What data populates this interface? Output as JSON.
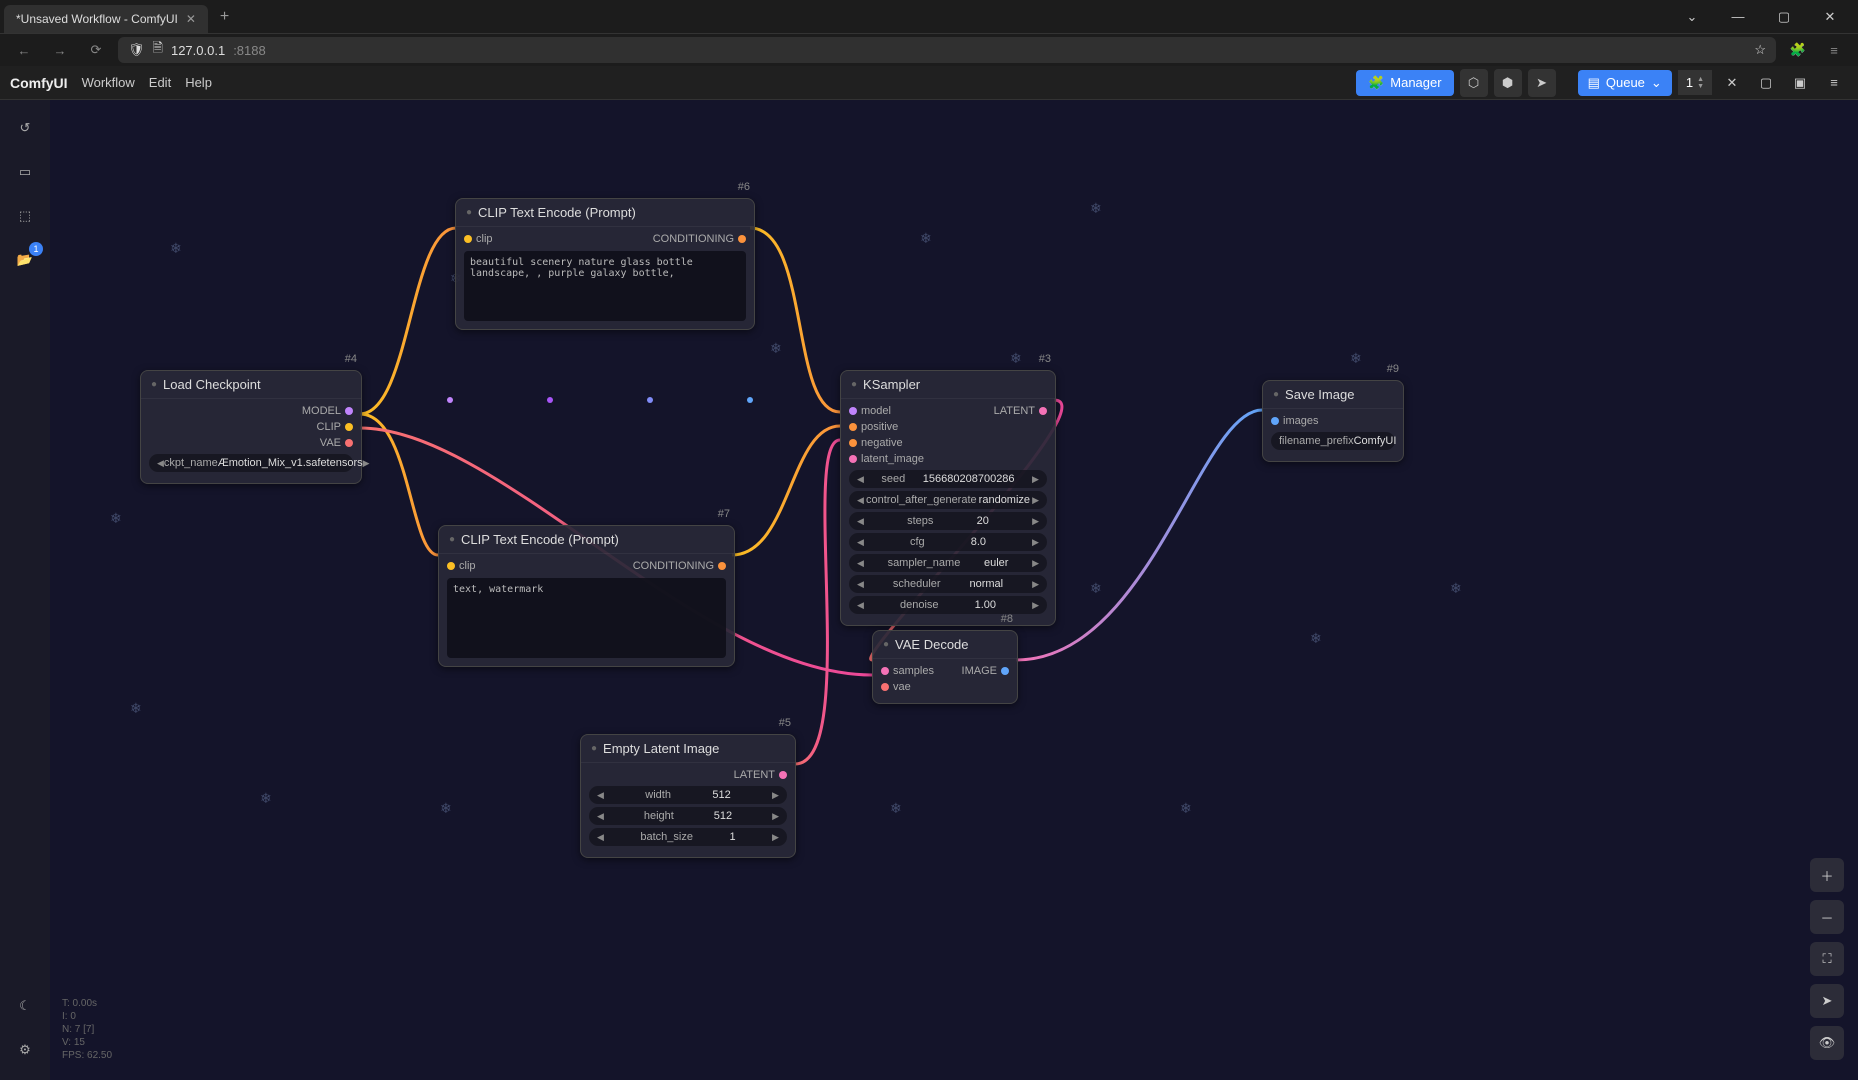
{
  "browser": {
    "tab_title": "*Unsaved Workflow - ComfyUI",
    "url_host": "127.0.0.1",
    "url_port": ":8188"
  },
  "menu": {
    "app": "ComfyUI",
    "items": [
      "Workflow",
      "Edit",
      "Help"
    ],
    "manager": "Manager",
    "queue": "Queue",
    "queue_count": "1",
    "folder_badge": "1"
  },
  "stats": {
    "t": "T: 0.00s",
    "i": "I: 0",
    "n": "N: 7 [7]",
    "v": "V: 15",
    "fps": "FPS: 62.50"
  },
  "nodes": {
    "load_ckpt": {
      "id": "#4",
      "title": "Load Checkpoint",
      "out_model": "MODEL",
      "out_clip": "CLIP",
      "out_vae": "VAE",
      "ckpt_label": "ckpt_name",
      "ckpt_value": "Æmotion_Mix_v1.safetensors"
    },
    "clip_pos": {
      "id": "#6",
      "title": "CLIP Text Encode (Prompt)",
      "in_clip": "clip",
      "out_cond": "CONDITIONING",
      "text": "beautiful scenery nature glass bottle landscape, , purple galaxy bottle,"
    },
    "clip_neg": {
      "id": "#7",
      "title": "CLIP Text Encode (Prompt)",
      "in_clip": "clip",
      "out_cond": "CONDITIONING",
      "text": "text, watermark"
    },
    "empty_latent": {
      "id": "#5",
      "title": "Empty Latent Image",
      "out_latent": "LATENT",
      "width_label": "width",
      "width_value": "512",
      "height_label": "height",
      "height_value": "512",
      "batch_label": "batch_size",
      "batch_value": "1"
    },
    "ksampler": {
      "id": "#3",
      "title": "KSampler",
      "in_model": "model",
      "in_positive": "positive",
      "in_negative": "negative",
      "in_latent": "latent_image",
      "out_latent": "LATENT",
      "seed_label": "seed",
      "seed_value": "156680208700286",
      "ctrl_label": "control_after_generate",
      "ctrl_value": "randomize",
      "steps_label": "steps",
      "steps_value": "20",
      "cfg_label": "cfg",
      "cfg_value": "8.0",
      "sampler_label": "sampler_name",
      "sampler_value": "euler",
      "sched_label": "scheduler",
      "sched_value": "normal",
      "denoise_label": "denoise",
      "denoise_value": "1.00"
    },
    "vae_decode": {
      "id": "#8",
      "title": "VAE Decode",
      "in_samples": "samples",
      "in_vae": "vae",
      "out_image": "IMAGE"
    },
    "save_image": {
      "id": "#9",
      "title": "Save Image",
      "in_images": "images",
      "prefix_label": "filename_prefix",
      "prefix_value": "ComfyUI"
    }
  }
}
